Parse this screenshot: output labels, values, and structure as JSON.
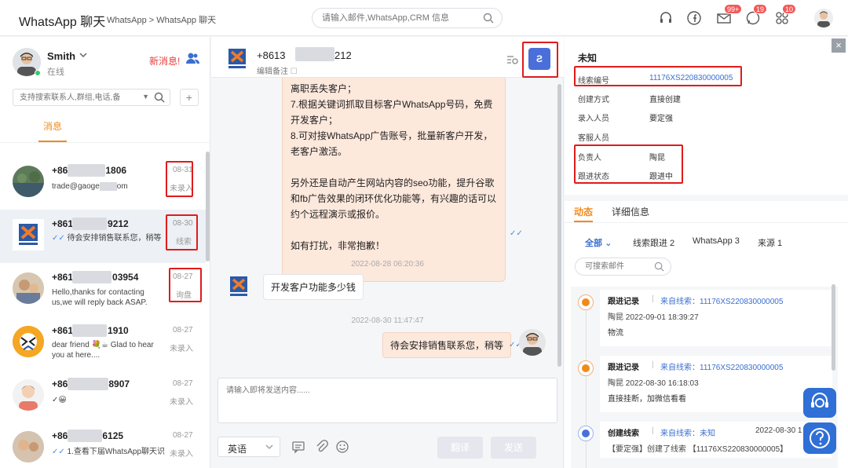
{
  "header": {
    "title": "WhatsApp 聊天",
    "breadcrumb": "WhatsApp > WhatsApp 聊天",
    "search_placeholder": "请输入邮件,WhatsApp,CRM 信息",
    "badges": {
      "mail": "99+",
      "chat": "19",
      "apps": "10"
    }
  },
  "me": {
    "name": "Smith",
    "status": "在线",
    "new_message": "新消息!",
    "search_placeholder": "支持搜索联系人,群组,电话,备",
    "tab_messages": "消息",
    "add": "+"
  },
  "conversations": [
    {
      "phone_prefix": "+86",
      "phone_suffix": "1806",
      "preview": "trade@gaoge",
      "preview2": "om",
      "date": "08-31",
      "status": "未录入"
    },
    {
      "phone_prefix": "+861",
      "phone_suffix": "9212",
      "preview": "待会安排销售联系您，稍等",
      "date": "08-30",
      "status": "线索"
    },
    {
      "phone_prefix": "+861",
      "phone_suffix": "03954",
      "preview": "Hello,thanks for contacting us,we will reply back ASAP.",
      "date": "08-27",
      "status": "询盘"
    },
    {
      "phone_prefix": "+861",
      "phone_suffix": "1910",
      "preview": "dear friend 💐☕ Glad to hear you at here....",
      "date": "08-27",
      "status": "未录入"
    },
    {
      "phone_prefix": "+86",
      "phone_suffix": "8907",
      "preview": "✓😀",
      "date": "08-27",
      "status": "未录入"
    },
    {
      "phone_prefix": "+86",
      "phone_suffix": "6125",
      "preview": "1.查看下届WhatsApp聊天识",
      "date": "08-27",
      "status": "未录入"
    }
  ],
  "chat": {
    "phone_prefix": "+8613",
    "phone_suffix": "212",
    "note": "编辑备注",
    "action_button": "Ƨ",
    "big_message": [
      "离职丢失客户；",
      "7.根据关键词抓取目标客户WhatsApp号码，免费开发客户；",
      "8.可对接WhatsApp广告账号，批量新客户开发，老客户激活。",
      "",
      "另外还是自动产生网站内容的seo功能，提升谷歌和fb广告效果的闭环优化功能等，有兴趣的话可以约个远程演示或报价。",
      "",
      "如有打扰，非常抱歉！"
    ],
    "ts1": "2022-08-28 06:20:36",
    "msg_in": "开发客户功能多少钱",
    "ts2": "2022-08-30 11:47:47",
    "msg_out": "待会安排销售联系您，稍等",
    "composer_placeholder": "请输入即将发送内容......",
    "language": "英语",
    "translate": "翻译",
    "send": "发送"
  },
  "lead": {
    "title": "未知",
    "fields": [
      {
        "label": "线索编号",
        "value": "11176XS220830000005"
      },
      {
        "label": "创建方式",
        "value": "直接创建"
      },
      {
        "label": "录入人员",
        "value": "要定强"
      },
      {
        "label": "客服人员",
        "value": ""
      },
      {
        "label": "负责人",
        "value": "陶昆"
      },
      {
        "label": "跟进状态",
        "value": "跟进中"
      }
    ],
    "tab_activity": "动态",
    "tab_detail": "详细信息",
    "filters": [
      "全部",
      "线索跟进 2",
      "WhatsApp 3",
      "来源 1"
    ],
    "mail_search_placeholder": "可搜索邮件"
  },
  "feed": [
    {
      "type": "跟进记录",
      "source": "来自线索：11176XS220830000005",
      "meta": "陶昆 2022-09-01 18:39:27",
      "body": "物流",
      "date": ""
    },
    {
      "type": "跟进记录",
      "source": "来自线索：11176XS220830000005",
      "meta": "陶昆 2022-08-30 16:18:03",
      "body": "直接挂断，加微信看看",
      "date": ""
    },
    {
      "type": "创建线索",
      "source": "来自线索：未知",
      "meta": "【要定强】创建了线索 【11176XS220830000005】",
      "body": "",
      "date": "2022-08-30 1"
    }
  ],
  "colors": {
    "accent": "#f28a1a",
    "link": "#3a6fd0",
    "highlight": "#e01b1b",
    "bubble": "#fde8dc"
  }
}
